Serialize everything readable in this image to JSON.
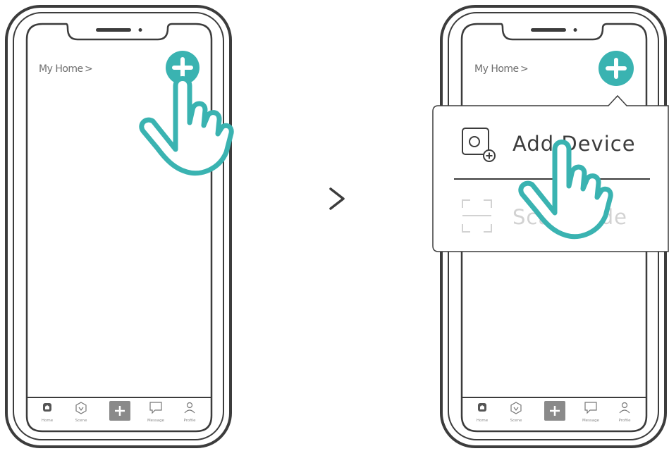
{
  "colors": {
    "accent": "#3ab3b1",
    "outline": "#3c3c3c",
    "muted": "#8a8a8a",
    "faded": "#d2d2d2"
  },
  "step_arrow": ">",
  "phones": [
    {
      "header": {
        "title": "My Home",
        "chevron": ">"
      },
      "add_icon": "plus-circle-icon",
      "nav": [
        "Home",
        "Scene",
        "",
        "Message",
        "Profile"
      ]
    },
    {
      "header": {
        "title": "My Home",
        "chevron": ">"
      },
      "add_icon": "plus-circle-icon",
      "nav": [
        "Home",
        "Scene",
        "",
        "Message",
        "Profile"
      ],
      "menu": {
        "items": [
          {
            "label": "Add Device",
            "icon": "add-device-icon"
          },
          {
            "label": "Scan Code",
            "icon": "scan-icon"
          }
        ]
      }
    }
  ]
}
